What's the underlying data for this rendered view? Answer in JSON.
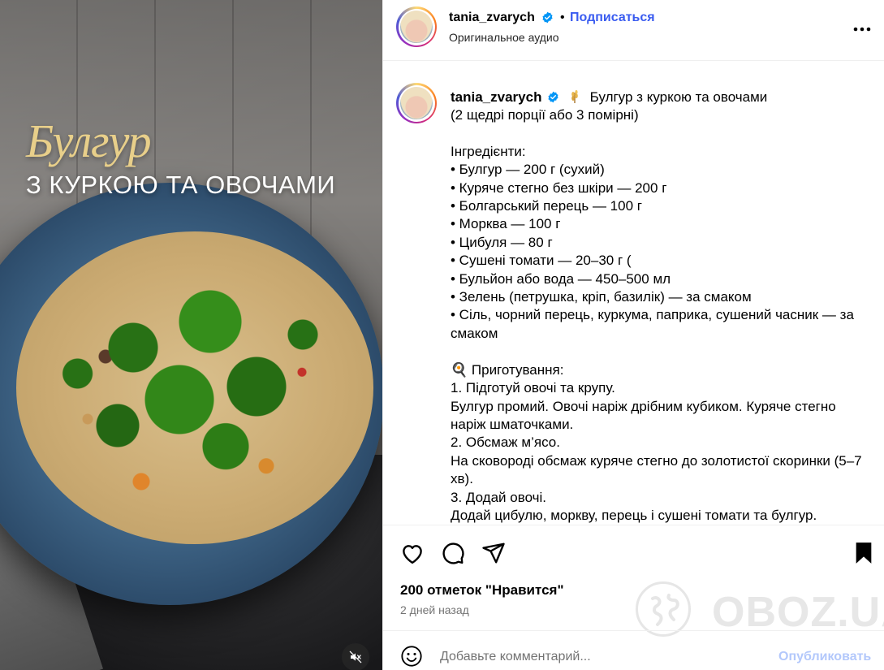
{
  "media": {
    "title_script": "Булгур",
    "title_sub": "З КУРКОЮ ТА ОВОЧАМИ",
    "mute_icon": "speaker-muted-icon"
  },
  "header": {
    "username": "tania_zvarych",
    "separator": "•",
    "follow_label": "Подписаться",
    "audio_label": "Оригинальное аудио",
    "more_icon": "more-options-icon"
  },
  "caption": {
    "username": "tania_zvarych",
    "title": "Булгур з куркою та овочами",
    "body": "(2 щедрі порції або 3 помірні)\n\nІнгредієнти:\n• Булгур — 200 г (сухий)\n• Куряче стегно без шкіри — 200 г\n• Болгарський перець — 100 г\n• Морква — 100 г\n• Цибуля — 80 г\n• Сушені томати — 20–30 г (\n• Бульйон або вода — 450–500 мл\n• Зелень (петрушка, кріп, базилік) — за смаком\n• Сіль, чорний перець, куркума, паприка, сушений часник — за смаком\n\n🍳 Приготування:\n1. Підготуй овочі та крупу.\nБулгур промий. Овочі наріж дрібним кубиком. Куряче стегно наріж шматочками.\n2. Обсмаж м’ясо.\nНа сковороді обсмаж куряче стегно до золотистої скоринки (5–7 хв).\n3. Додай овочі.\nДодай цибулю, моркву, перець і сушені томати та булгур."
  },
  "actions": {
    "likes": "200 отметок \"Нравится\"",
    "time_ago": "2 дней назад"
  },
  "watermark": {
    "text": "OBOZ.UA"
  },
  "comment": {
    "placeholder": "Добавьте комментарий...",
    "post_label": "Опубликовать"
  },
  "colors": {
    "accent_blue": "#3a5cf0",
    "post_disabled": "#b3c8fb",
    "verified_blue": "#0095f6",
    "title_gold": "#e8cf8a"
  }
}
